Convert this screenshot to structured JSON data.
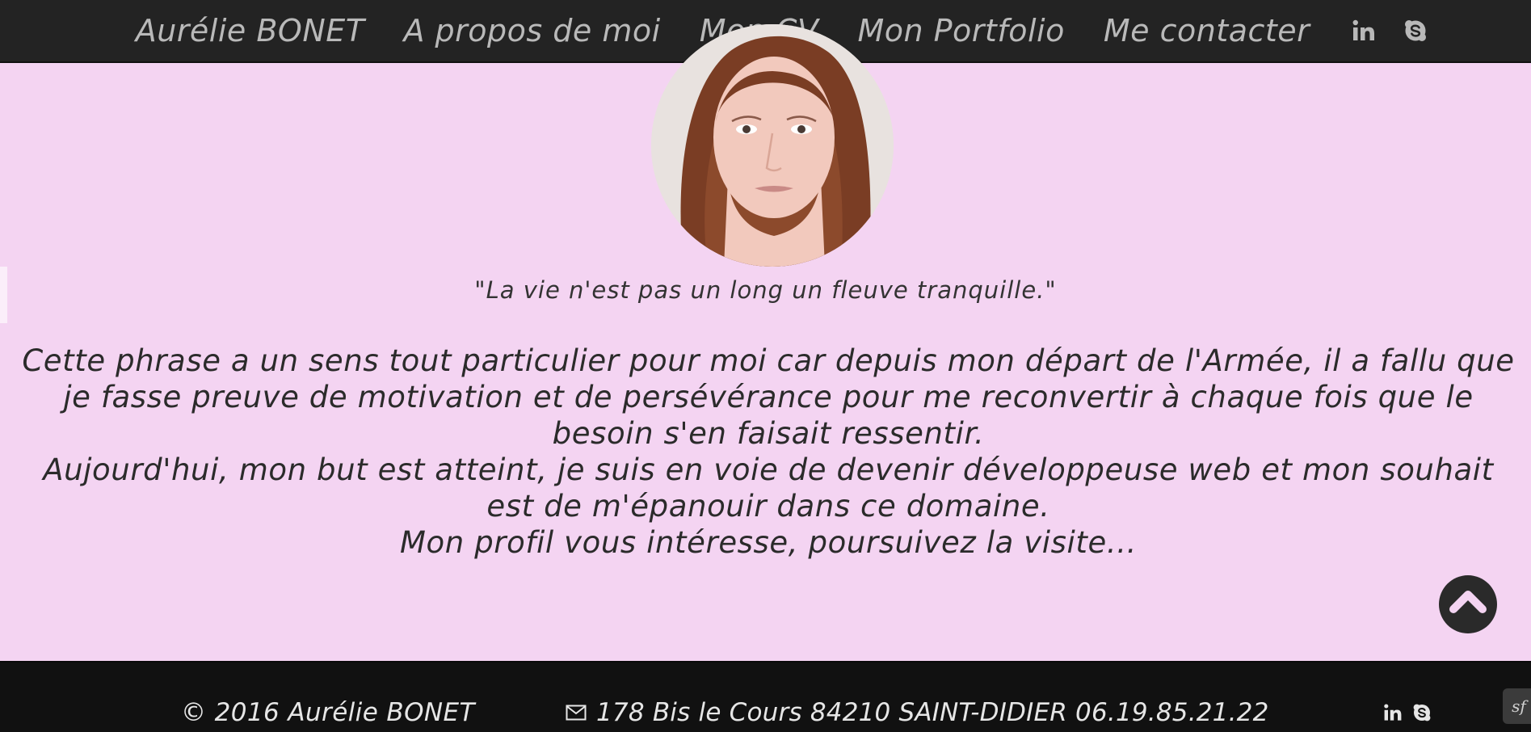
{
  "nav": {
    "brand": "Aurélie BONET",
    "links": [
      "A propos de moi",
      "Mon CV",
      "Mon Portfolio",
      "Me contacter"
    ],
    "icons": [
      "linkedin-icon",
      "skype-icon"
    ]
  },
  "profile": {
    "quote": "\"La vie n'est pas un long un fleuve tranquille.\"",
    "paragraph1": "Cette phrase a un sens tout particulier pour moi car depuis mon départ de l'Armée, il a fallu que je fasse preuve de motivation et de persévérance pour me reconvertir à chaque fois que le besoin s'en faisait ressentir.",
    "paragraph2": "Aujourd'hui, mon but est atteint, je suis en voie de devenir développeuse web et mon souhait est de m'épanouir dans ce domaine.",
    "paragraph3": "Mon profil vous intéresse, poursuivez la visite..."
  },
  "footer": {
    "copyright": "© 2016 Aurélie BONET",
    "address": "178 Bis le Cours 84210 SAINT-DIDIER 06.19.85.21.22",
    "icons": [
      "linkedin-icon",
      "skype-icon"
    ]
  },
  "colors": {
    "page_bg": "#f4d4f2",
    "nav_bg": "#232323",
    "footer_bg": "#111111",
    "nav_text": "#b9b9b9"
  }
}
